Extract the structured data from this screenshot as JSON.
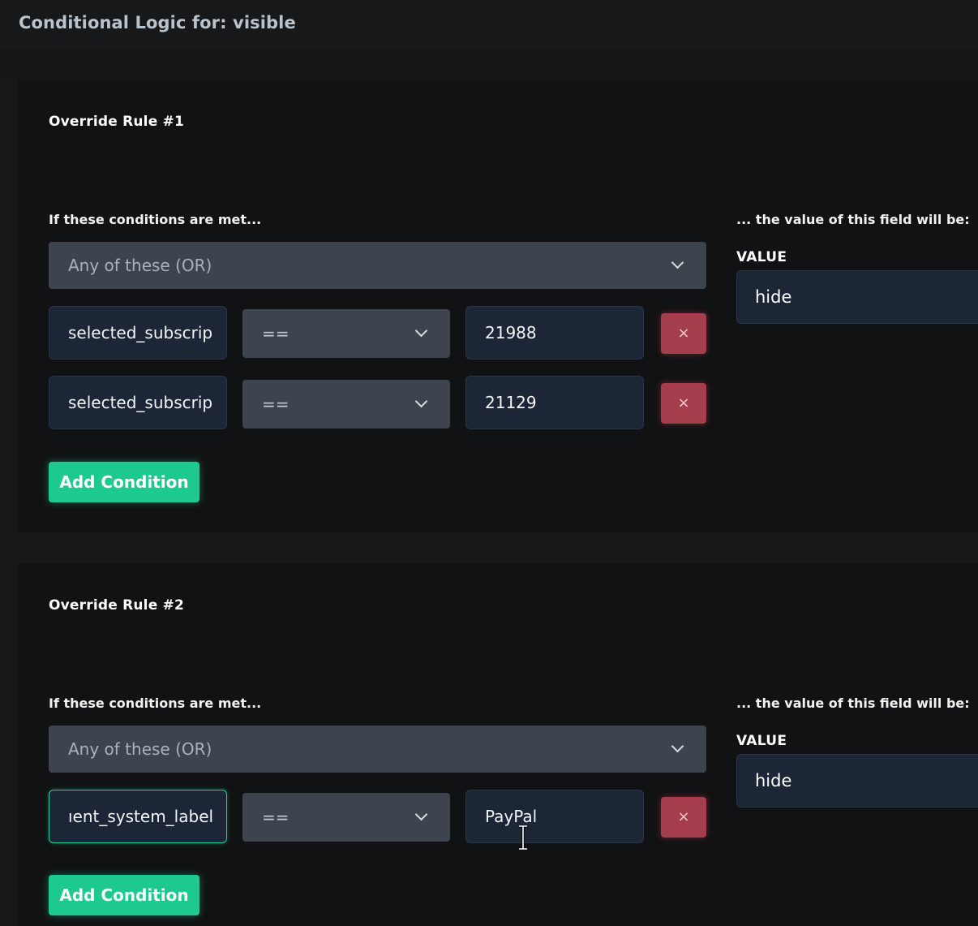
{
  "page": {
    "title": "Conditional Logic for: visible"
  },
  "rules": [
    {
      "title": "Override Rule #1",
      "conditions_heading": "If these conditions are met...",
      "result_heading": "... the value of this field will be:",
      "value_label": "VALUE",
      "value": "hide",
      "logic_mode": "Any of these (OR)",
      "conditions": [
        {
          "field": "selected_subscrip",
          "operator": "==",
          "value": "21988",
          "remove_label": "×"
        },
        {
          "field": "selected_subscrip",
          "operator": "==",
          "value": "21129",
          "remove_label": "×"
        }
      ],
      "add_condition_label": "Add Condition"
    },
    {
      "title": "Override Rule #2",
      "conditions_heading": "If these conditions are met...",
      "result_heading": "... the value of this field will be:",
      "value_label": "VALUE",
      "value": "hide",
      "logic_mode": "Any of these (OR)",
      "conditions": [
        {
          "field": "ıent_system_label",
          "operator": "==",
          "value": "PayPal",
          "remove_label": "×"
        }
      ],
      "add_condition_label": "Add Condition"
    }
  ],
  "colors": {
    "accent_green": "#1ec98f",
    "remove_red": "#a43e4c",
    "input_bg": "#1d2637",
    "select_bg": "#3d444e"
  },
  "icons": {
    "dropdown": "chevron-down-icon",
    "remove": "close-icon",
    "cursor": "text-cursor-icon"
  }
}
